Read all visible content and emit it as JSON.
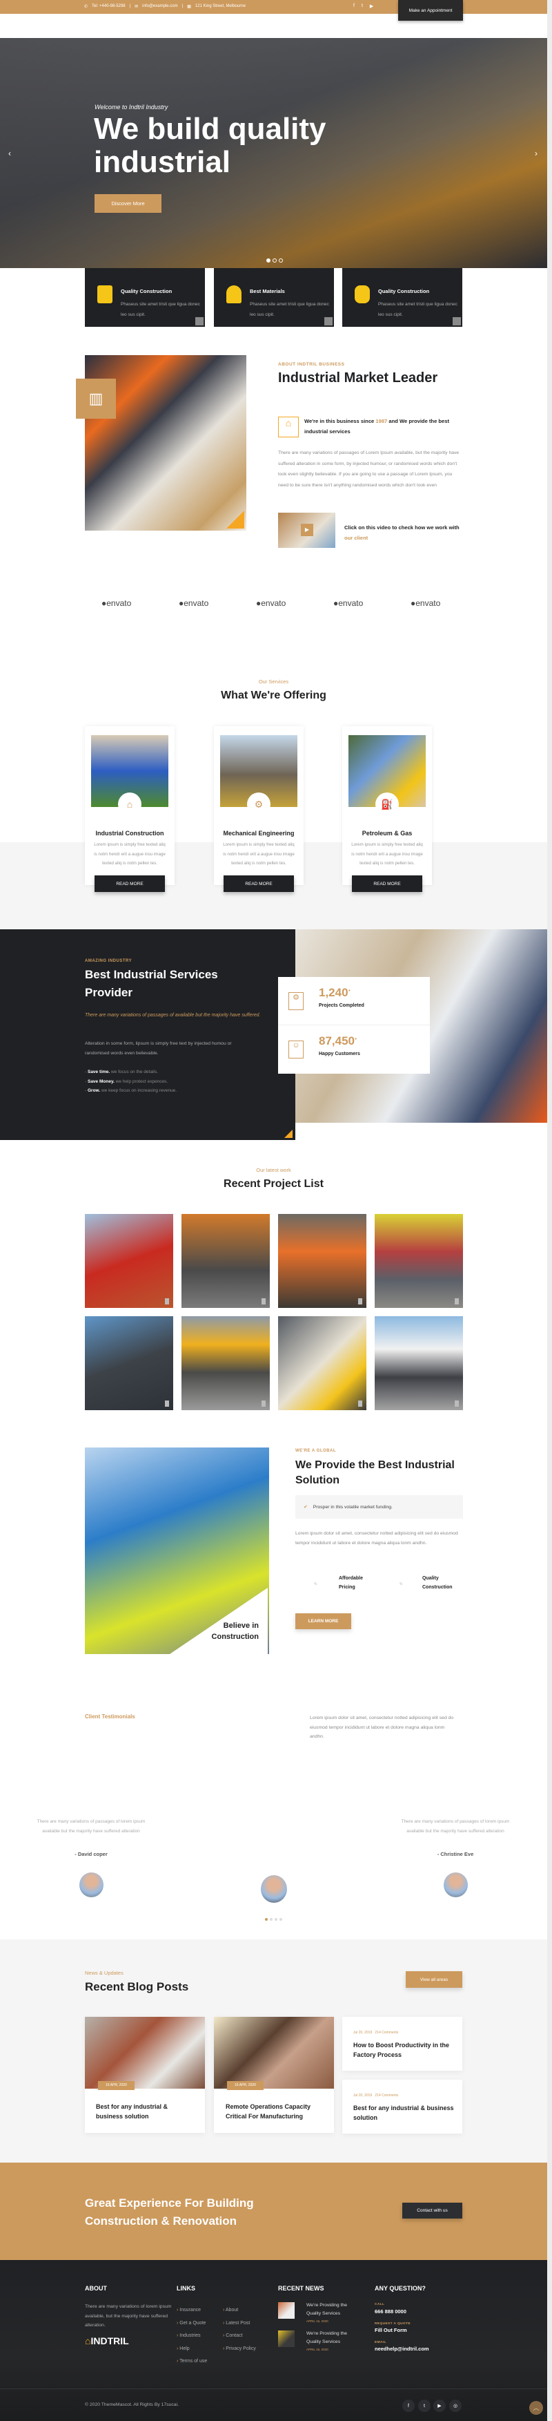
{
  "topbar": {
    "phone": "Tel: +440-98-5298",
    "email": "info@example.com",
    "address": "121 King Street, Melbourne",
    "socials": [
      "facebook-icon",
      "twitter-icon",
      "youtube-icon"
    ],
    "appointment": "Make an Appointment"
  },
  "hero": {
    "welcome": "Welcome to Indtril Industry",
    "title": "We build quality industrial",
    "button": "Discover More"
  },
  "features": [
    {
      "title": "Quality Construction",
      "desc": "Phaseus site amet tristi que ligua donec leo sus cipit."
    },
    {
      "title": "Best Materials",
      "desc": "Phaseus site amet tristi que ligua donec leo sus cipit."
    },
    {
      "title": "Quality Construction",
      "desc": "Phaseus site amet tristi que ligua donec leo sus cipit."
    }
  ],
  "about": {
    "tag": "ABOUT INDTRIL BUSINESS",
    "title": "Industrial Market Leader",
    "lead_a": "We're in this business since ",
    "lead_year": "1987",
    "lead_b": " and We provide the best industrial services",
    "body": "There are many variations of passages of Lorem Ipsum available, but the majority have suffered alteration in some form, by injected humour, or randomised words which don't look even slightly believable. If you are going to use a passage of Lorem Ipsum, you need to be sure there isn't anything randomised words which don't look even",
    "video_a": "Click on this video to check how we work with ",
    "video_link": "our client"
  },
  "logos": [
    "envato",
    "envato",
    "envato",
    "envato",
    "envato"
  ],
  "services": {
    "tag": "Our Services",
    "title": "What We're Offering",
    "items": [
      {
        "title": "Industrial Construction",
        "desc": "Lorem ipsum is simply free texted aliq is notm hendr erit a augue insu image texted aliq is notm pellen tes.",
        "button": "READ MORE"
      },
      {
        "title": "Mechanical Engineering",
        "desc": "Lorem ipsum is simply free texted aliq is notm hendr erit a augue insu image texted aliq is notm pellen tes.",
        "button": "READ MORE"
      },
      {
        "title": "Petroleum & Gas",
        "desc": "Lorem ipsum is simply free texted aliq is notm hendr erit a augue insu image texted aliq is notm pellen tes.",
        "button": "READ MORE"
      }
    ]
  },
  "provider": {
    "tag": "AMAZING INDUSTRY",
    "title": "Best Industrial Services Provider",
    "italic": "There are many variations of passages of available but the majority have suffered.",
    "body": "Alteration in some form, lipsum is simply free text by injected humou or randomised words even believable.",
    "list": [
      {
        "b": "Save time.",
        "t": " we focus on the details."
      },
      {
        "b": "Save Money.",
        "t": " we help protect expences."
      },
      {
        "b": "Grow.",
        "t": " we keep focus on increasing revenue."
      }
    ],
    "stats": [
      {
        "value": "1,240",
        "sup": "+",
        "label": "Projects Completed"
      },
      {
        "value": "87,450",
        "sup": "+",
        "label": "Happy Customers"
      }
    ]
  },
  "projects": {
    "tag": "Our latest work",
    "title": "Recent Project List"
  },
  "solution": {
    "tag": "WE'RE A GLOBAL",
    "title": "We Provide the Best Industrial Solution",
    "check": "Prosper in this volatile market funding.",
    "body": "Lorem ipsum dolor sit amet, consectetur notted adipisicing elit sed do eiusmod tempor incididunt ut labore et dolore magna aliqua lonm andhn.",
    "features": [
      "Affordable Pricing",
      "Quality Construction"
    ],
    "button": "LEARN MORE",
    "badge": "Believe in Construction"
  },
  "testimonials": {
    "tag": "Client Testimonials",
    "intro": "Lorem ipsum dolor sit amet, consectetur notted adipisicing elit sed do eiusmod tempor incididunt ut labore et dolore magna aliqua lonm andhn.",
    "items": [
      {
        "text": "There are many variations of passages of lorem ipsum available but the majority have suffered alteration",
        "name": "- David coper"
      },
      {
        "text": "There are many variations of passages of lorem ipsum available but the majority have suffered alteration",
        "name": "- Christine Eve"
      }
    ]
  },
  "blog": {
    "tag": "News & Updates",
    "title": "Recent Blog Posts",
    "button": "View all areas",
    "posts": [
      {
        "date": "16 APR, 2020",
        "title": "Best for any industrial & business solution"
      },
      {
        "date": "16 APR, 2020",
        "title": "Remote Operations Capacity Critical For Manufacturing"
      },
      {
        "meta_date": "Jul 20, 2019",
        "comments": "214 Comments",
        "title": "How to Boost Productivity in the Factory Process"
      },
      {
        "meta_date": "Jul 20, 2019",
        "comments": "214 Comments",
        "title": "Best for any industrial & business solution"
      }
    ]
  },
  "cta": {
    "title": "Great Experience For Building Construction & Renovation",
    "button": "Contact with us"
  },
  "footer": {
    "about_h": "ABOUT",
    "about": "There are many variations of lorem ipsum available, but the majority have suffered alteration.",
    "brand": "INDTRIL",
    "links_h": "LINKS",
    "links_a": [
      "Insurance",
      "Get a Quote",
      "Industries",
      "Help",
      "Terms of use"
    ],
    "links_b": [
      "About",
      "Latest Post",
      "Contact",
      "Privacy Policy"
    ],
    "news_h": "RECENT NEWS",
    "news": [
      {
        "title": "We're Providing the Quality Services",
        "date": "APRIL 16, 2020"
      },
      {
        "title": "We're Providing the Quality Services",
        "date": "APRIL 16, 2020"
      }
    ],
    "q_h": "ANY QUESTION?",
    "call_l": "CALL",
    "call": "666 888 0000",
    "quote_l": "REQUEST A QUOTE",
    "quote": "Fill Out Form",
    "email_l": "EMAIL",
    "email": "needhelp@indtril.com",
    "copyright": "© 2020 ThemeMascot. All Rights By 17sucai.",
    "socials": [
      "facebook-icon",
      "twitter-icon",
      "youtube-icon",
      "instagram-icon"
    ]
  },
  "colors": {
    "accent": "#cd9a5d",
    "dark": "#1f2124"
  }
}
